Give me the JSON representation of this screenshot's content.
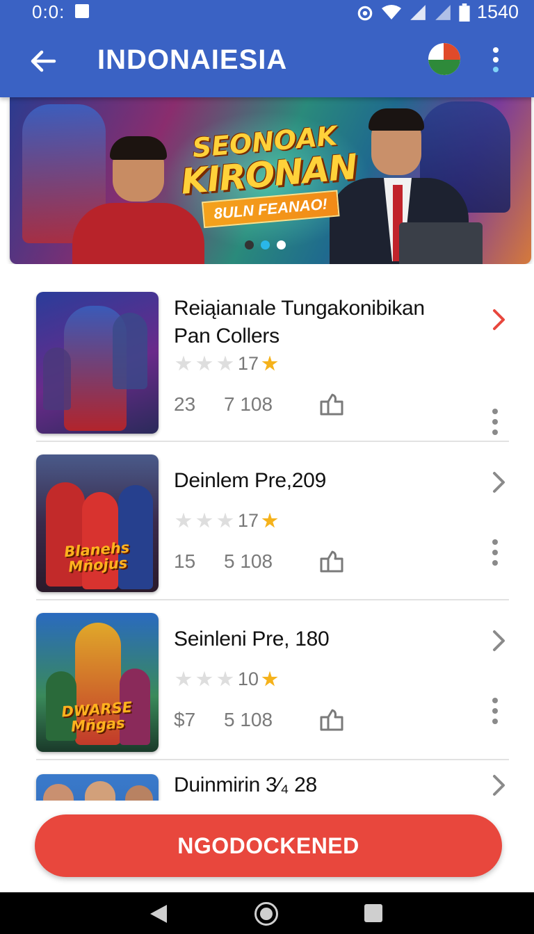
{
  "status_bar": {
    "time": "0:0:",
    "battery_text": "1540"
  },
  "app_bar": {
    "title": "INDONAIESIA"
  },
  "banner": {
    "line1": "SEONOAK",
    "line2": "KIRONAN",
    "subtitle": "8ULN FEANAO!",
    "dots": [
      "#333333",
      "#2ab7e8",
      "#ffffff"
    ]
  },
  "items": [
    {
      "name": "Reiąianıale Tungakonibikan Pan Collers",
      "rating": "17",
      "stat1": "23",
      "stat2": "7 108",
      "chevron_color": "#e8473d"
    },
    {
      "name": "Deinlem  Pre,209",
      "rating": "17",
      "stat1": "15",
      "stat2": "5 108",
      "chevron_color": "#8a8a8a",
      "thumb_text": "Blanehs Mñojus"
    },
    {
      "name": "Seinleni  Pre, 180",
      "rating": "10",
      "stat1": "$7",
      "stat2": "5 108",
      "chevron_color": "#8a8a8a",
      "thumb_text": "DWARSE Mñgas"
    },
    {
      "name": "Duinmirin 3⁄₄ 28",
      "chevron_color": "#8a8a8a"
    }
  ],
  "cta": {
    "label": "NGODOCKENED"
  },
  "colors": {
    "app_bar": "#3a62c4",
    "accent": "#e8473d",
    "star": "#f5b21b"
  }
}
